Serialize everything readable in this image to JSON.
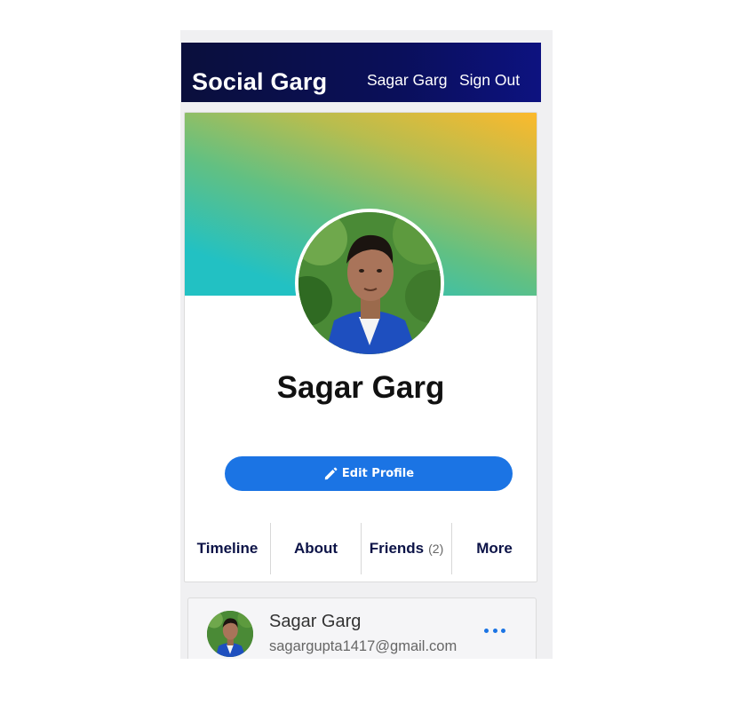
{
  "navbar": {
    "brand": "Social Garg",
    "user_link": "Sagar Garg",
    "signout_link": "Sign Out"
  },
  "profile": {
    "name": "Sagar Garg",
    "edit_button_label": "Edit Profile"
  },
  "tabs": [
    {
      "label": "Timeline"
    },
    {
      "label": "About"
    },
    {
      "label": "Friends",
      "count": "(2)"
    },
    {
      "label": "More"
    }
  ],
  "post": {
    "author": "Sagar Garg",
    "email": "sagargupta1417@gmail.com"
  },
  "colors": {
    "navbar": "#0a0f5a",
    "accent": "#1b74e4",
    "cover_top": "#fcb92c",
    "cover_bottom": "#22c1c3"
  },
  "icons": {
    "edit": "pencil-icon",
    "more": "more-dots-icon"
  }
}
